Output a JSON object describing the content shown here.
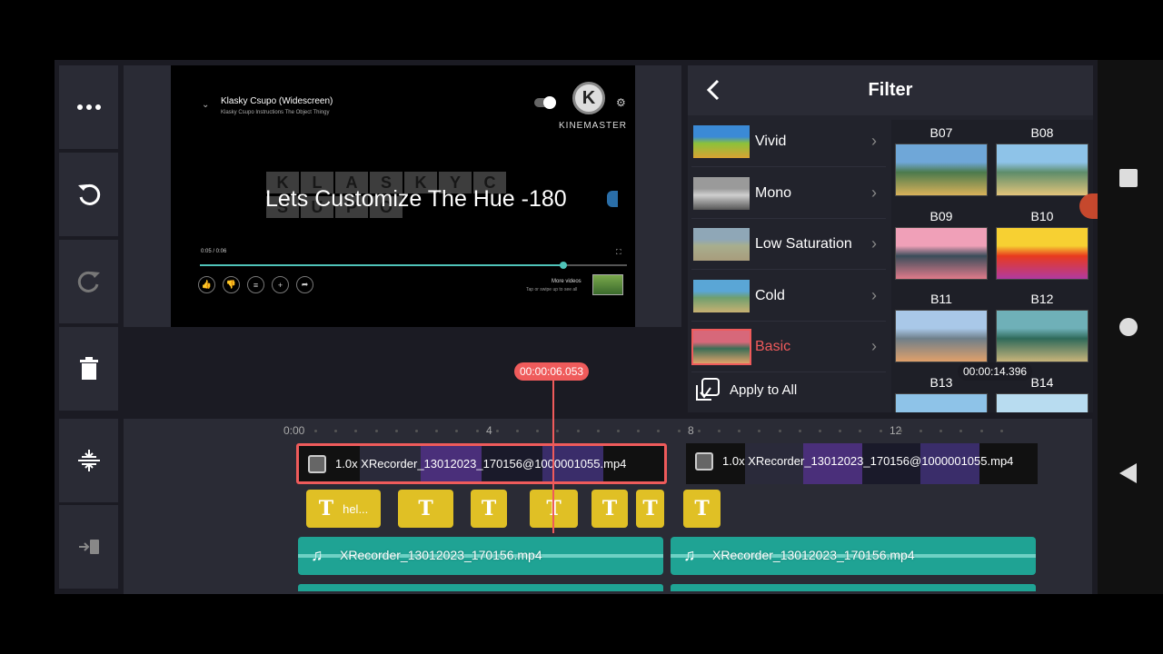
{
  "preview": {
    "video_title": "Klasky Csupo (Widescreen)",
    "video_subtitle": "Klasky Csupo Instructions The Object Thingy",
    "watermark": "KINEMASTER",
    "watermark_logo_letter": "K",
    "caption": "Lets Customize The Hue -180",
    "time": "0:05 / 0:06",
    "progress_fraction": 0.85,
    "more_videos": "More videos",
    "more_videos_sub": "Tap or swipe up to see all",
    "logo_tiles": [
      "K",
      "L",
      "A",
      "S",
      "K",
      "Y",
      "C",
      "S",
      "U",
      "P",
      "O"
    ]
  },
  "left_rail": {
    "buttons": [
      {
        "name": "more-button",
        "icon": "more-dots-icon"
      },
      {
        "name": "undo-button",
        "icon": "undo-icon"
      },
      {
        "name": "redo-button",
        "icon": "redo-icon"
      },
      {
        "name": "delete-button",
        "icon": "trash-icon"
      }
    ]
  },
  "filter": {
    "title": "Filter",
    "categories": [
      {
        "label": "Vivid",
        "active": false,
        "colors": [
          "#3b8ad6",
          "#8cc23a",
          "#d9a233"
        ]
      },
      {
        "label": "Mono",
        "active": false,
        "colors": [
          "#9a9a9a",
          "#cfcfcf",
          "#555555"
        ]
      },
      {
        "label": "Low Saturation",
        "active": false,
        "colors": [
          "#8fa7b7",
          "#a8ae8d",
          "#a89c7c"
        ]
      },
      {
        "label": "Cold",
        "active": false,
        "colors": [
          "#5aa6d6",
          "#6f9f6e",
          "#c8b172"
        ]
      },
      {
        "label": "Basic",
        "active": true,
        "colors": [
          "#d7687a",
          "#3b6e56",
          "#e0a36a"
        ]
      }
    ],
    "apply_all": "Apply to All",
    "presets": [
      {
        "label": "B07",
        "colors": [
          "#6fa7d8",
          "#4c7a4c",
          "#d9b25a"
        ]
      },
      {
        "label": "B08",
        "colors": [
          "#8ec3e8",
          "#5e8d6a",
          "#e2c47a"
        ]
      },
      {
        "label": "B09",
        "colors": [
          "#f0a0b8",
          "#3a4d5a",
          "#e07a8a"
        ]
      },
      {
        "label": "B10",
        "colors": [
          "#f7d032",
          "#e83a1e",
          "#b03aa0"
        ]
      },
      {
        "label": "B11",
        "colors": [
          "#a9c8e8",
          "#6f7f8a",
          "#e0a06a"
        ]
      },
      {
        "label": "B12",
        "colors": [
          "#6fb0b8",
          "#2f6a5a",
          "#c8b47a"
        ]
      },
      {
        "label": "B13",
        "colors": [
          "#8ec3e8",
          "#6f9a6a",
          "#d9c07a"
        ]
      },
      {
        "label": "B14",
        "colors": [
          "#b8dcf0",
          "#7a9aa0",
          "#e0d0a0"
        ]
      }
    ]
  },
  "timeline": {
    "ruler_labels": [
      "0:00",
      "4",
      "8",
      "12"
    ],
    "playhead_time": "00:00:06.053",
    "end_time": "00:00:14.396",
    "video_clips": [
      {
        "label": "1.0x XRecorder_13012023_170156@1000001055.mp4",
        "selected": true
      },
      {
        "label": "1.0x XRecorder_13012023_170156@1000001055.mp4",
        "selected": false
      }
    ],
    "text_clips": [
      {
        "label": "hel..."
      },
      {
        "label": ""
      },
      {
        "label": ""
      },
      {
        "label": ""
      },
      {
        "label": ""
      },
      {
        "label": ""
      },
      {
        "label": ""
      }
    ],
    "text_icon": "T",
    "audio_clips": [
      {
        "label": "XRecorder_13012023_170156.mp4"
      },
      {
        "label": "XRecorder_13012023_170156.mp4"
      }
    ]
  },
  "colors": {
    "accent": "#ef5b5b",
    "panel": "#2a2b35",
    "background": "#1b1b23",
    "text_clip": "#e0c025",
    "audio_clip": "#1fa394"
  }
}
